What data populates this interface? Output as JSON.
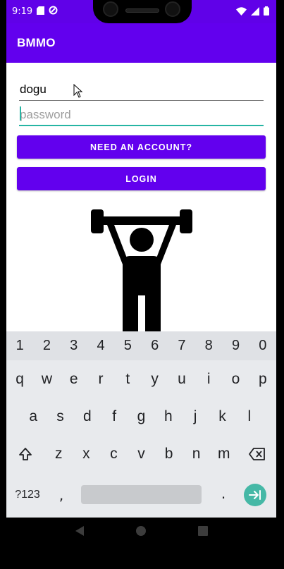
{
  "status_bar": {
    "time": "9:19"
  },
  "app_bar": {
    "title": "BMMO"
  },
  "login": {
    "username_value": "dogu",
    "password_placeholder": "password",
    "need_account_label": "NEED AN ACCOUNT?",
    "login_label": "LOGIN"
  },
  "keyboard": {
    "numbers": [
      "1",
      "2",
      "3",
      "4",
      "5",
      "6",
      "7",
      "8",
      "9",
      "0"
    ],
    "row1": [
      "q",
      "w",
      "e",
      "r",
      "t",
      "y",
      "u",
      "i",
      "o",
      "p"
    ],
    "row2": [
      "a",
      "s",
      "d",
      "f",
      "g",
      "h",
      "j",
      "k",
      "l"
    ],
    "row3": [
      "z",
      "x",
      "c",
      "v",
      "b",
      "n",
      "m"
    ],
    "symbols_label": "?123",
    "comma": ",",
    "period": "."
  },
  "icons": [
    "sd-card-icon",
    "sync-icon",
    "wifi-icon",
    "signal-icon",
    "battery-icon",
    "weightlifter-icon",
    "shift-icon",
    "backspace-icon",
    "enter-icon",
    "back-icon",
    "home-icon",
    "recents-icon"
  ],
  "colors": {
    "primary": "#6200ee",
    "status_bar": "#6001e8",
    "accent": "#26b5a3"
  }
}
